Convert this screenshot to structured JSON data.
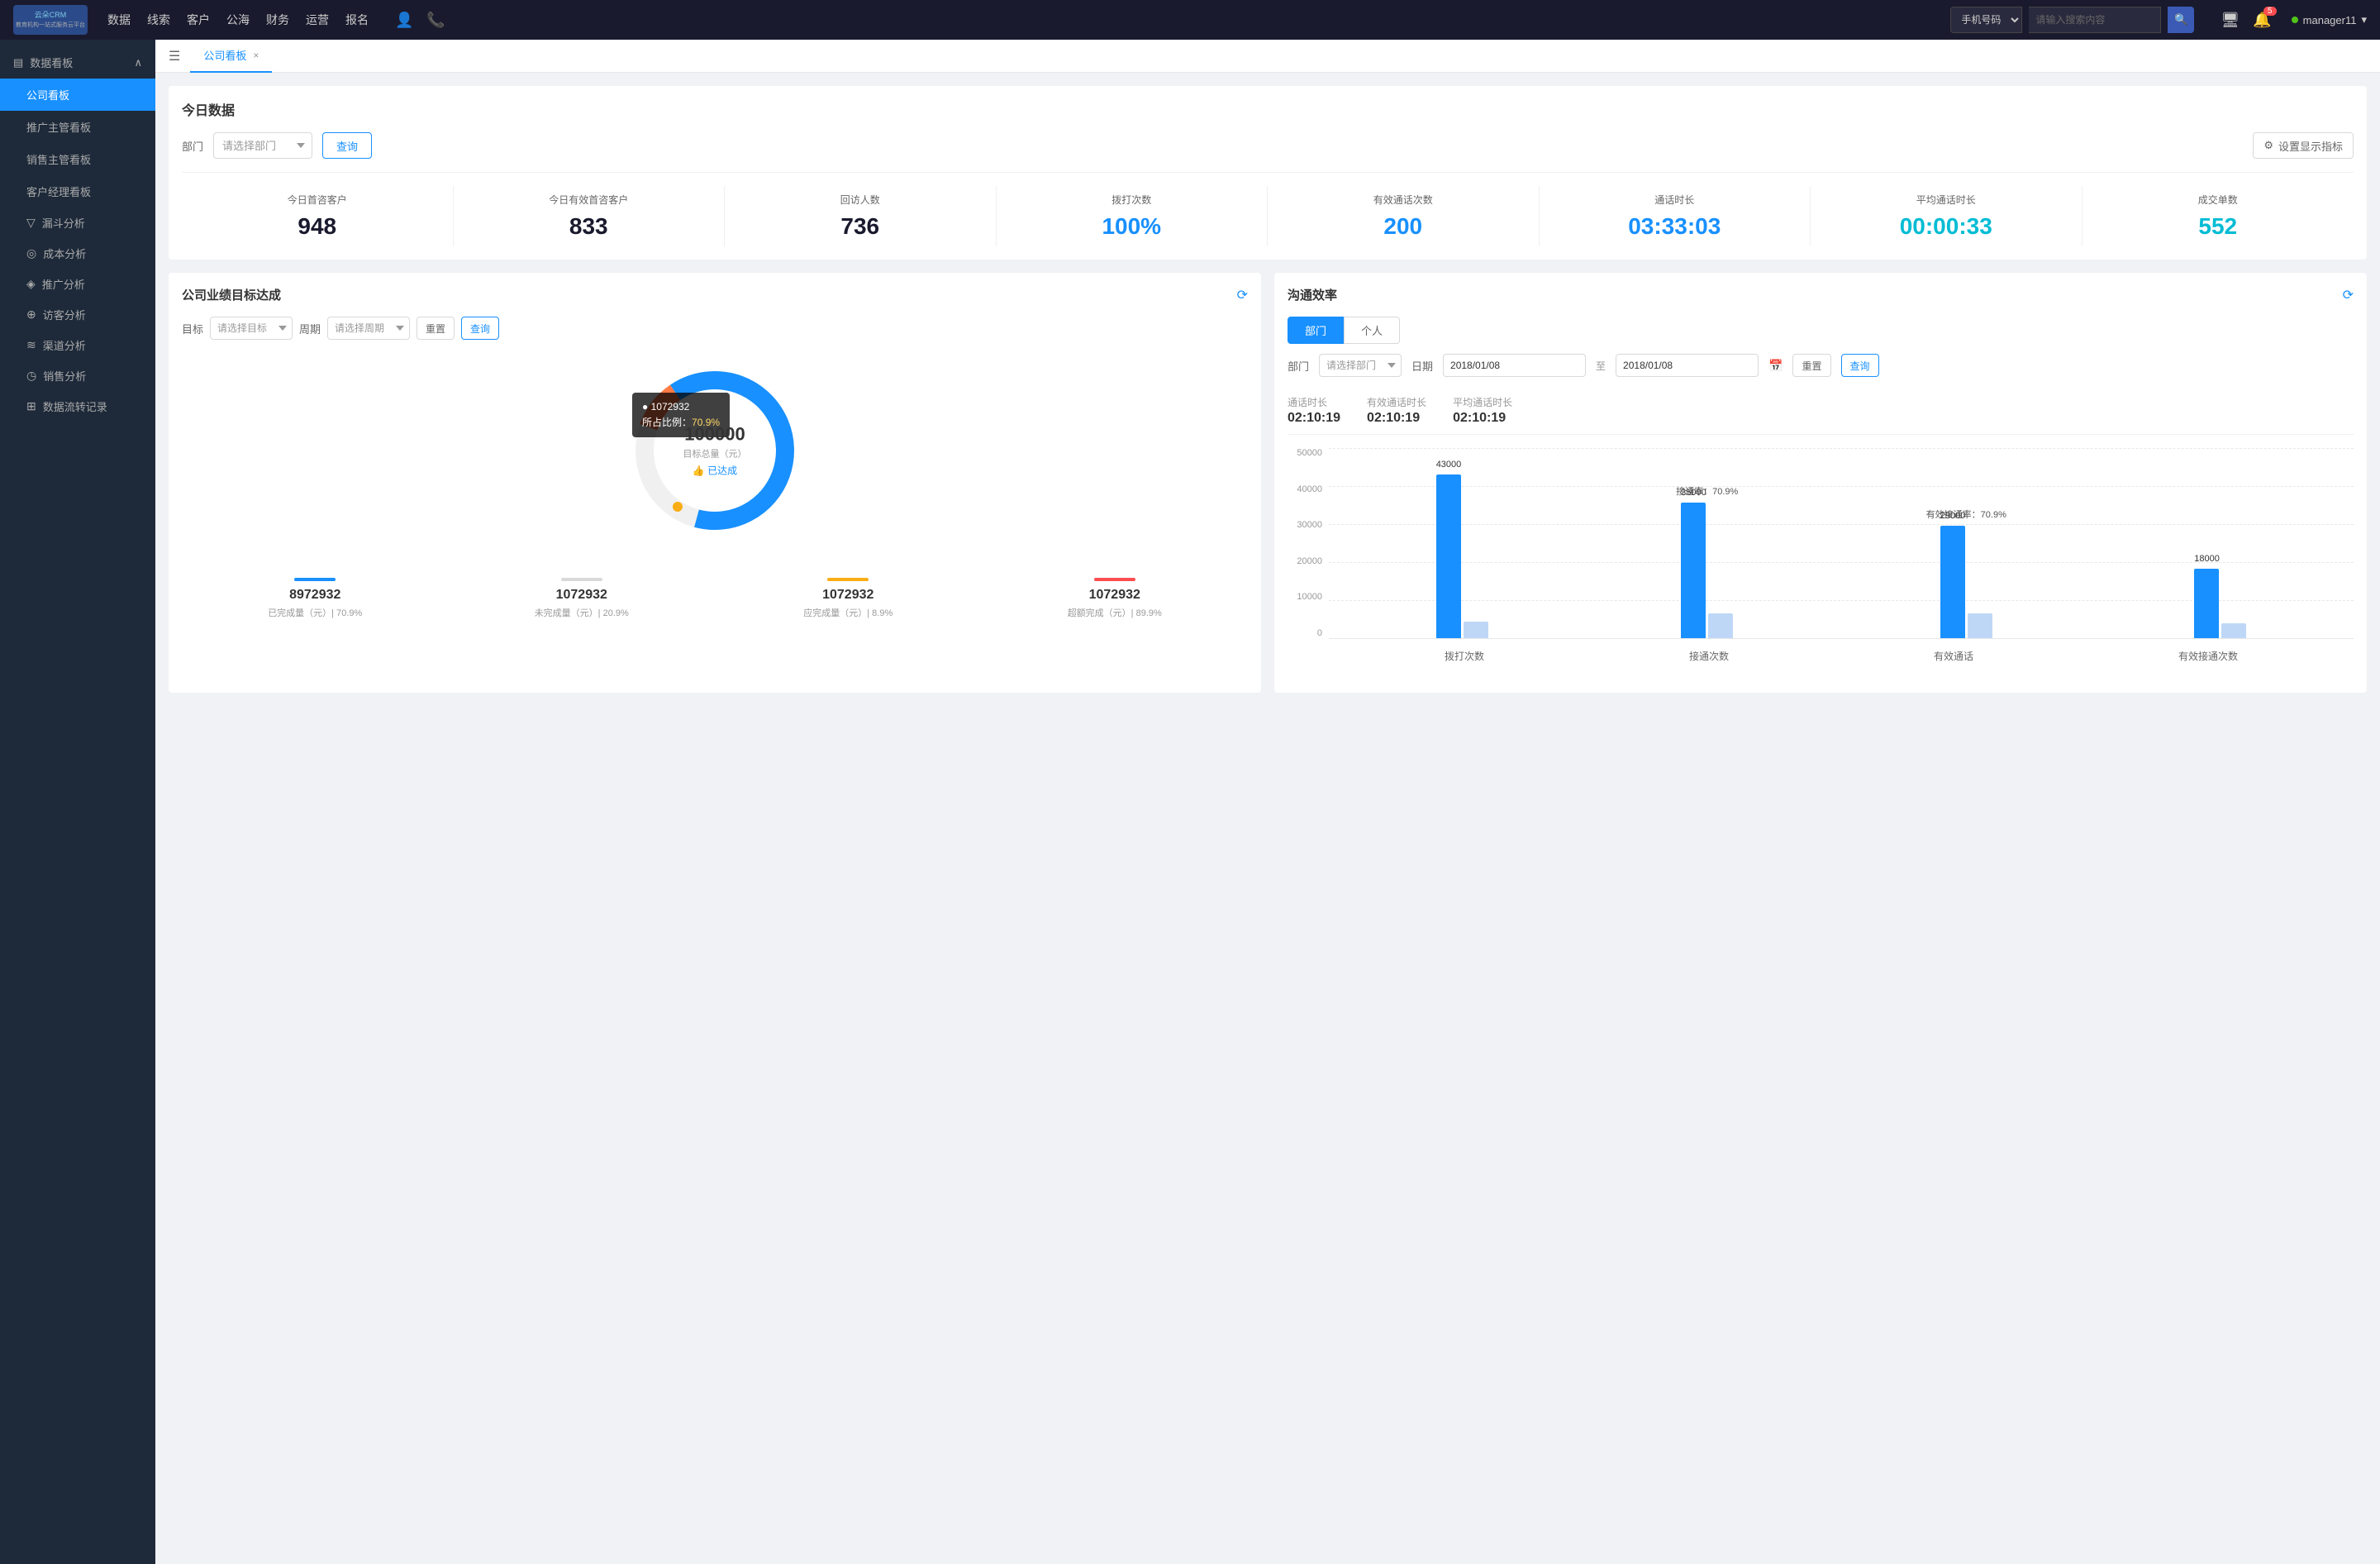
{
  "topNav": {
    "logo": "云朵CRM",
    "logoSub": "教育机构一站式服务云平台",
    "items": [
      "数据",
      "线索",
      "客户",
      "公海",
      "财务",
      "运营",
      "报名"
    ],
    "searchPlaceholder": "请输入搜索内容",
    "searchSelect": "手机号码",
    "badgeCount": "5",
    "username": "manager11"
  },
  "sidebar": {
    "dashboardHeader": "数据看板",
    "activeItem": "公司看板",
    "items": [
      {
        "label": "公司看板",
        "active": true
      },
      {
        "label": "推广主管看板",
        "active": false
      },
      {
        "label": "销售主管看板",
        "active": false
      },
      {
        "label": "客户经理看板",
        "active": false
      }
    ],
    "subItems": [
      {
        "icon": "▽",
        "label": "漏斗分析"
      },
      {
        "icon": "◎",
        "label": "成本分析"
      },
      {
        "icon": "◈",
        "label": "推广分析"
      },
      {
        "icon": "⊕",
        "label": "访客分析"
      },
      {
        "icon": "≋",
        "label": "渠道分析"
      },
      {
        "icon": "◷",
        "label": "销售分析"
      },
      {
        "icon": "⊞",
        "label": "数据流转记录"
      }
    ]
  },
  "tabs": [
    {
      "label": "公司看板",
      "active": true
    }
  ],
  "todayData": {
    "title": "今日数据",
    "filterLabel": "部门",
    "filterPlaceholder": "请选择部门",
    "queryBtn": "查询",
    "settingsBtn": "设置显示指标",
    "stats": [
      {
        "label": "今日首咨客户",
        "value": "948",
        "color": "dark"
      },
      {
        "label": "今日有效首咨客户",
        "value": "833",
        "color": "dark"
      },
      {
        "label": "回访人数",
        "value": "736",
        "color": "dark"
      },
      {
        "label": "拨打次数",
        "value": "100%",
        "color": "blue"
      },
      {
        "label": "有效通话次数",
        "value": "200",
        "color": "blue"
      },
      {
        "label": "通话时长",
        "value": "03:33:03",
        "color": "blue"
      },
      {
        "label": "平均通话时长",
        "value": "00:00:33",
        "color": "cyan"
      },
      {
        "label": "成交单数",
        "value": "552",
        "color": "cyan"
      }
    ]
  },
  "businessPanel": {
    "title": "公司业绩目标达成",
    "targetLabel": "目标",
    "targetPlaceholder": "请选择目标",
    "periodLabel": "周期",
    "periodPlaceholder": "请选择周期",
    "resetBtn": "重置",
    "queryBtn": "查询",
    "donut": {
      "value": "100000",
      "label": "目标总量（元）",
      "achieved": "👍 已达成",
      "tooltip": {
        "id": "1072932",
        "percent": "70.9%",
        "percentLabel": "所占比例："
      }
    },
    "bottomStats": [
      {
        "color": "#1890ff",
        "value": "8972932",
        "label": "已完成量（元）| 70.9%",
        "barColor": "#1890ff"
      },
      {
        "color": "#d9d9d9",
        "value": "1072932",
        "label": "未完成量（元）| 20.9%",
        "barColor": "#d9d9d9"
      },
      {
        "color": "#faad14",
        "value": "1072932",
        "label": "应完成量（元）| 8.9%",
        "barColor": "#faad14"
      },
      {
        "color": "#ff4d4f",
        "value": "1072932",
        "label": "超额完成（元）| 89.9%",
        "barColor": "#ff4d4f"
      }
    ]
  },
  "commPanel": {
    "title": "沟通效率",
    "tabs": [
      "部门",
      "个人"
    ],
    "activeTab": "部门",
    "filterLabel": "部门",
    "filterPlaceholder": "请选择部门",
    "dateLabel": "日期",
    "dateFrom": "2018/01/08",
    "dateTo": "2018/01/08",
    "resetBtn": "重置",
    "queryBtn": "查询",
    "stats": {
      "callDuration": {
        "label": "通话时长",
        "value": "02:10:19"
      },
      "effectiveDuration": {
        "label": "有效通话时长",
        "value": "02:10:19"
      },
      "avgDuration": {
        "label": "平均通话时长",
        "value": "02:10:19"
      }
    },
    "chart": {
      "yLabels": [
        "50000",
        "40000",
        "30000",
        "20000",
        "10000",
        "0"
      ],
      "groups": [
        {
          "label": "拨打次数",
          "mainVal": 43000,
          "mainHeight": 200,
          "lightVal": null,
          "lightHeight": 0,
          "rateLabel": null
        },
        {
          "label": "接通次数",
          "mainVal": 35000,
          "mainHeight": 165,
          "lightVal": null,
          "lightHeight": 30,
          "rateLabel": "接通率：70.9%",
          "rateLabelPos": "center"
        },
        {
          "label": "有效通话",
          "mainVal": 29000,
          "mainHeight": 136,
          "lightVal": null,
          "lightHeight": 30,
          "rateLabel": "有效接通率：70.9%",
          "rateLabelPos": "right"
        },
        {
          "label": "有效接通次数",
          "mainVal": 18000,
          "mainHeight": 85,
          "lightVal": null,
          "lightHeight": 20
        }
      ]
    }
  }
}
